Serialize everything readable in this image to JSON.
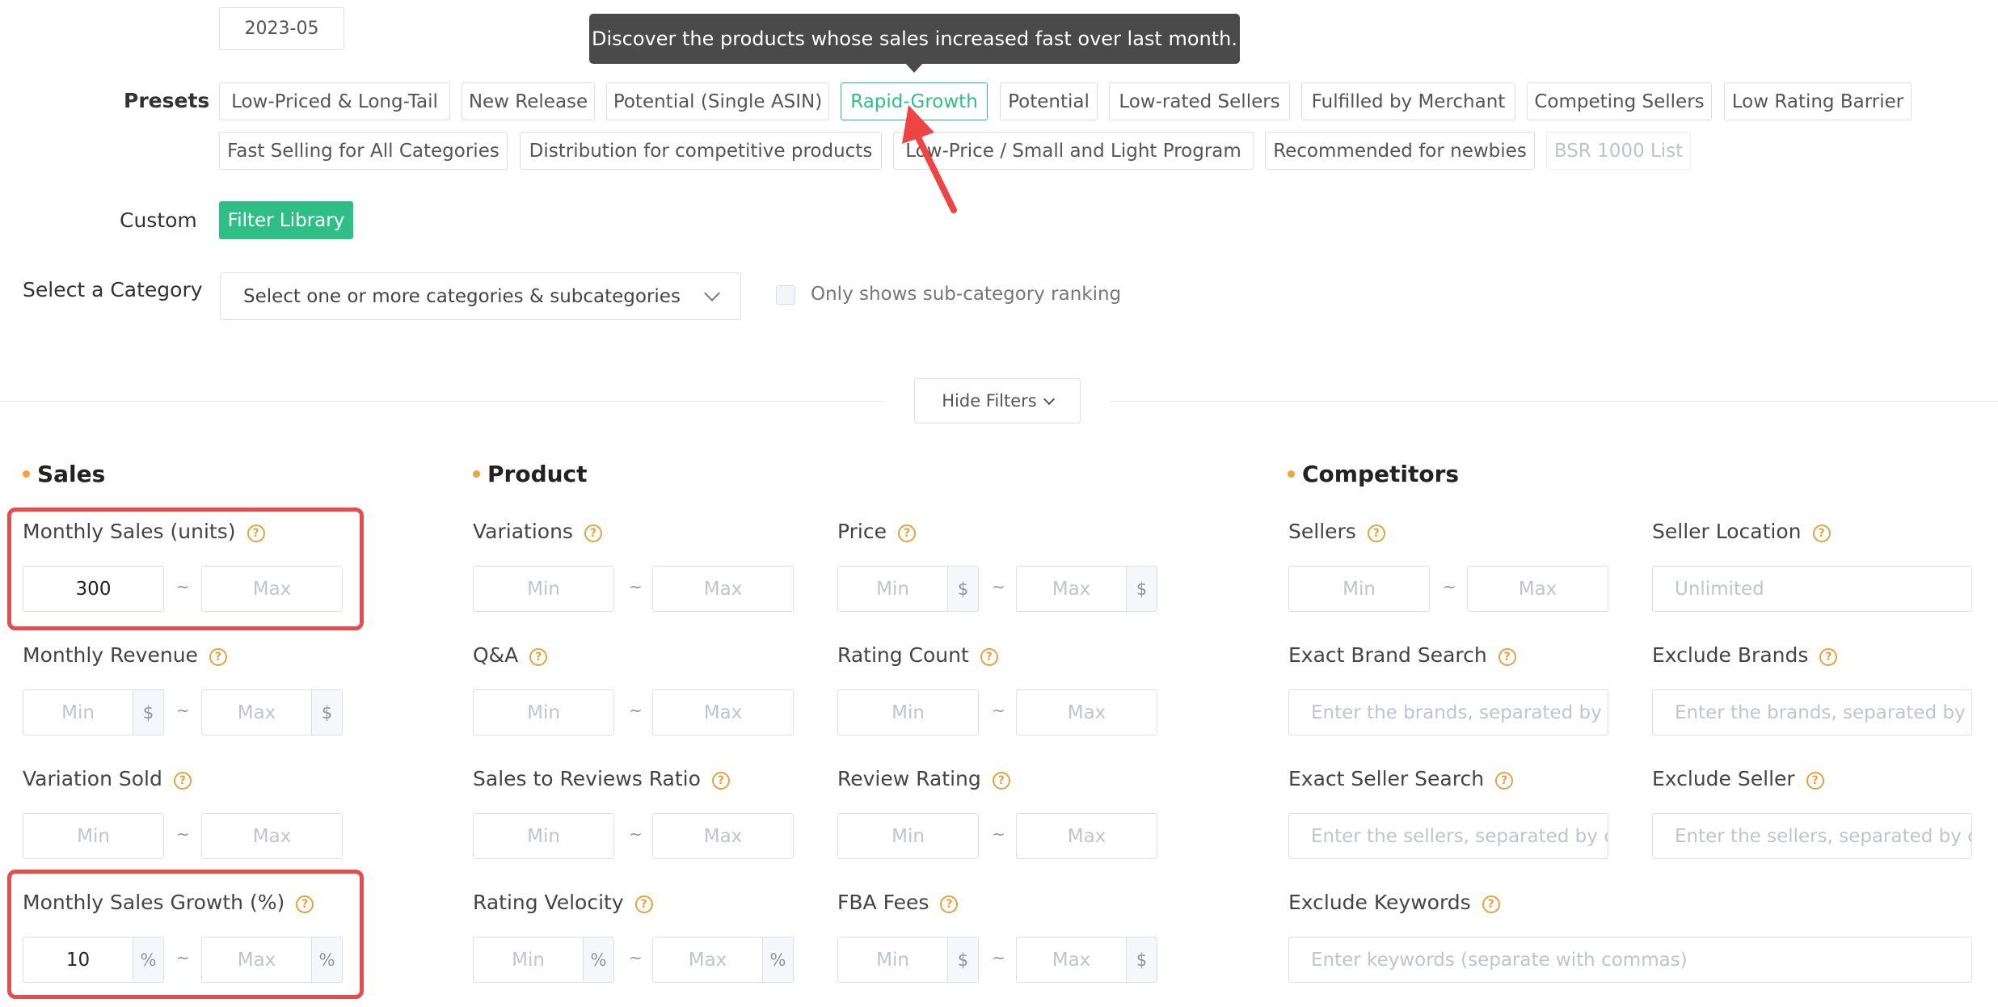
{
  "date": "2023-05",
  "presets": {
    "label": "Presets",
    "tooltip": "Discover the products whose sales increased fast over last month.",
    "items": [
      "Low-Priced & Long-Tail",
      "New Release",
      "Potential (Single ASIN)",
      "Rapid-Growth",
      "Potential",
      "Low-rated Sellers",
      "Fulfilled by Merchant",
      "Competing Sellers",
      "Low Rating Barrier",
      "Fast Selling for All Categories",
      "Distribution for competitive products",
      "Low-Price / Small and Light Program",
      "Recommended for newbies",
      "BSR 1000 List"
    ],
    "active": "Rapid-Growth",
    "disabled": "BSR 1000 List"
  },
  "custom": {
    "label": "Custom",
    "button": "Filter Library"
  },
  "category": {
    "label": "Select a Category",
    "placeholder": "Select one or more categories & subcategories",
    "checkbox_label": "Only shows sub-category ranking"
  },
  "hide_filters": "Hide Filters",
  "tilde": "~",
  "help_glyph": "?",
  "sections": {
    "sales": {
      "title": "Sales",
      "monthly_sales": {
        "label": "Monthly Sales (units)",
        "min": "300",
        "max_ph": "Max"
      },
      "monthly_revenue": {
        "label": "Monthly Revenue",
        "min_ph": "Min",
        "max_ph": "Max",
        "unit": "$"
      },
      "variation_sold": {
        "label": "Variation Sold",
        "min_ph": "Min",
        "max_ph": "Max"
      },
      "monthly_growth": {
        "label": "Monthly Sales Growth (%)",
        "min": "10",
        "max_ph": "Max",
        "unit": "%"
      }
    },
    "product": {
      "title": "Product",
      "variations": {
        "label": "Variations",
        "min_ph": "Min",
        "max_ph": "Max"
      },
      "price": {
        "label": "Price",
        "min_ph": "Min",
        "max_ph": "Max",
        "unit": "$"
      },
      "qa": {
        "label": "Q&A",
        "min_ph": "Min",
        "max_ph": "Max"
      },
      "rating_count": {
        "label": "Rating Count",
        "min_ph": "Min",
        "max_ph": "Max"
      },
      "sales_reviews": {
        "label": "Sales to Reviews Ratio",
        "min_ph": "Min",
        "max_ph": "Max"
      },
      "review_rating": {
        "label": "Review Rating",
        "min_ph": "Min",
        "max_ph": "Max"
      },
      "rating_velocity": {
        "label": "Rating Velocity",
        "min_ph": "Min",
        "max_ph": "Max",
        "unit": "%"
      },
      "fba_fees": {
        "label": "FBA Fees",
        "min_ph": "Min",
        "max_ph": "Max",
        "unit": "$"
      }
    },
    "competitors": {
      "title": "Competitors",
      "sellers": {
        "label": "Sellers",
        "min_ph": "Min",
        "max_ph": "Max"
      },
      "seller_location": {
        "label": "Seller Location",
        "placeholder": "Unlimited"
      },
      "exact_brand": {
        "label": "Exact Brand Search",
        "placeholder": "Enter the brands, separated by c"
      },
      "exclude_brands": {
        "label": "Exclude Brands",
        "placeholder": "Enter the brands, separated by c"
      },
      "exact_seller": {
        "label": "Exact Seller Search",
        "placeholder": "Enter the sellers, separated by cc"
      },
      "exclude_seller": {
        "label": "Exclude Seller",
        "placeholder": "Enter the sellers, separated by cc"
      },
      "exclude_keywords": {
        "label": "Exclude Keywords",
        "placeholder": "Enter keywords (separate with commas)"
      }
    }
  },
  "colors": {
    "accent": "#2fbf86",
    "highlight": "#e74c4c",
    "section_dot": "#f5a23a"
  }
}
